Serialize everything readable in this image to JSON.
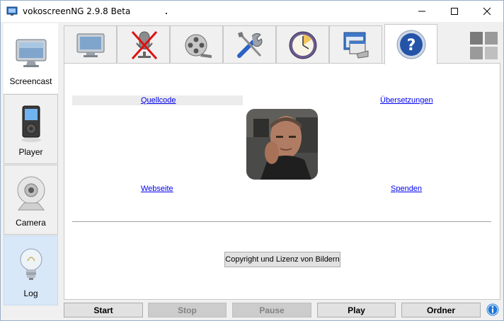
{
  "window": {
    "title": "vokoscreenNG 2.9.8 Beta",
    "controls": {
      "minimize_glyph": "—",
      "maximize_glyph": "☐",
      "close_glyph": "✕"
    }
  },
  "sidebar": {
    "items": [
      {
        "label": "Screencast",
        "icon": "monitor-icon",
        "active": true
      },
      {
        "label": "Player",
        "icon": "media-player-icon",
        "active": false
      },
      {
        "label": "Camera",
        "icon": "webcam-icon",
        "active": false
      },
      {
        "label": "Log",
        "icon": "lightbulb-icon",
        "active": false
      }
    ]
  },
  "tabs": [
    {
      "icon": "monitor-icon",
      "active": false
    },
    {
      "icon": "microphone-muted-icon",
      "active": false
    },
    {
      "icon": "film-reel-icon",
      "active": false
    },
    {
      "icon": "tools-icon",
      "active": false
    },
    {
      "icon": "timer-icon",
      "active": false
    },
    {
      "icon": "window-stack-icon",
      "active": false
    },
    {
      "icon": "help-icon",
      "active": true
    }
  ],
  "about": {
    "links": {
      "source_code": "Quellcode",
      "translations": "Übersetzungen",
      "website": "Webseite",
      "donate": "Spenden"
    },
    "copyright_button": "Copyright und Lizenz von Bildern"
  },
  "bottom_bar": {
    "start": "Start",
    "stop": "Stop",
    "pause": "Pause",
    "play": "Play",
    "folder": "Ordner"
  },
  "colors": {
    "link": "#0000ee",
    "accent": "#1e78d7",
    "log_highlight": "#d9e8f8"
  }
}
